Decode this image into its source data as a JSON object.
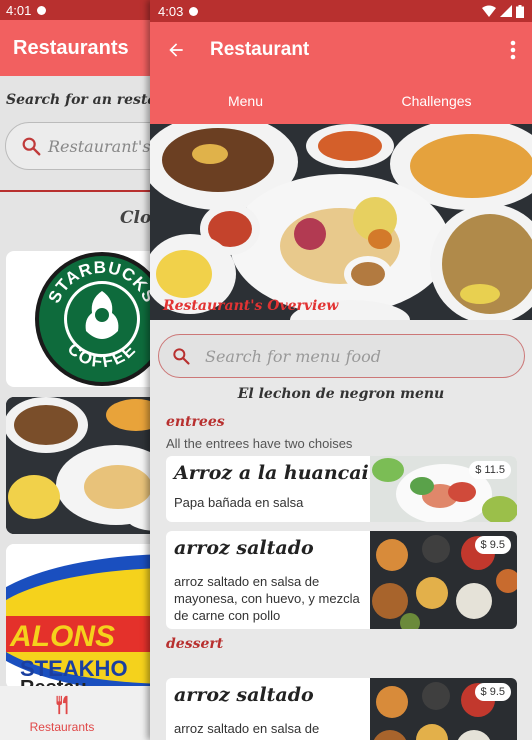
{
  "back": {
    "status_time": "4:01",
    "app_title": "Restaurants",
    "search_label": "Search for an restau",
    "search_placeholder": "Restaurant's n",
    "closest_label": "Clos",
    "starbucks_top": "STARBUCKS",
    "starbucks_bottom": "COFFEE",
    "alonso_top": "ALONS",
    "alonso_mid": "STEAKHO",
    "alonso_bot": "Restau",
    "nav_restaurants": "Restaurants"
  },
  "front": {
    "status_time": "4:03",
    "app_title": "Restaurant",
    "tabs": [
      {
        "label": "Menu"
      },
      {
        "label": "Challenges"
      }
    ],
    "overview_label": "Restaurant's Overview",
    "search_placeholder": "Search for menu food",
    "menu_title": "El lechon de negron menu",
    "sections": {
      "entrees": "entrees",
      "entrees_note": "All the entrees have two choises",
      "dessert": "dessert"
    },
    "items": [
      {
        "name": "Arroz a la huancaina",
        "desc": "Papa bañada en salsa",
        "price": "$ 11.5"
      },
      {
        "name": "arroz saltado",
        "desc": "arroz saltado en salsa de mayonesa, con huevo, y mezcla de carne con pollo",
        "price": "$ 9.5"
      },
      {
        "name": "arroz saltado",
        "desc": "arroz saltado en salsa de",
        "price": "$ 9.5"
      }
    ]
  },
  "colors": {
    "status_bar": "#b8302f",
    "app_bar": "#f26060",
    "accent_red": "#e23333"
  },
  "icons": [
    "back-arrow-icon",
    "more-vert-icon",
    "search-icon",
    "wifi-icon",
    "signal-icon",
    "battery-icon",
    "fork-knife-icon"
  ]
}
